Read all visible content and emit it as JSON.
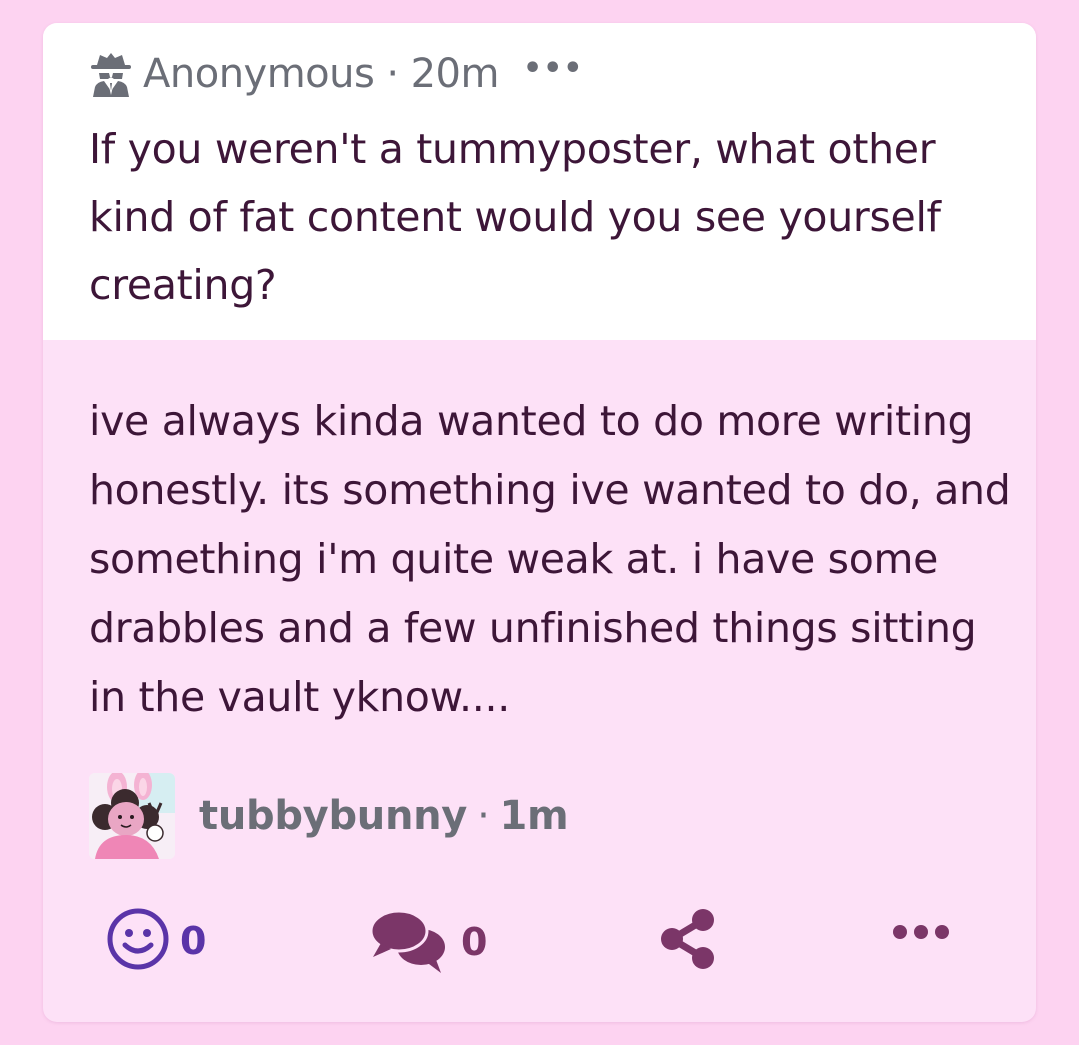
{
  "ask": {
    "icon": "anonymous-spy-icon",
    "author": "Anonymous",
    "separator": "·",
    "time": "20m",
    "more_label": "•••",
    "question": "If you weren't a tummyposter, what other kind of fat content would you see yourself creating?"
  },
  "answer": {
    "text": "ive always kinda wanted to do more writing honestly. its something ive wanted to do, and something i'm quite weak at. i have some drabbles and a few unfinished things sitting in the vault yknow...."
  },
  "author": {
    "username": "tubbybunny",
    "separator": "·",
    "time": "1m",
    "avatar": "user-avatar"
  },
  "actions": {
    "react_count": "0",
    "comment_count": "0",
    "icons": [
      "smile-icon",
      "comment-bubbles-icon",
      "share-icon",
      "more-dots-icon"
    ]
  },
  "colors": {
    "page_bg": "#fdd3f1",
    "card_bg": "#fde1f7",
    "ask_bg": "#ffffff",
    "text": "#3d1638",
    "muted": "#6b6e77",
    "smile": "#5a34a8",
    "comment": "#7b3668"
  }
}
